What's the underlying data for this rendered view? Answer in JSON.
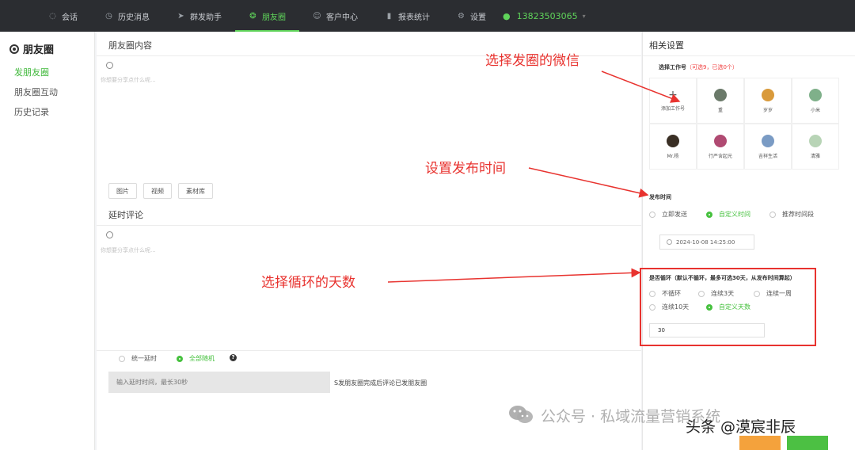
{
  "nav": {
    "items": [
      {
        "label": "会话",
        "icon": "chat-icon"
      },
      {
        "label": "历史消息",
        "icon": "clock-icon"
      },
      {
        "label": "群发助手",
        "icon": "send-icon"
      },
      {
        "label": "朋友圈",
        "icon": "moments-icon"
      },
      {
        "label": "客户中心",
        "icon": "user-icon"
      },
      {
        "label": "报表统计",
        "icon": "bar-chart-icon"
      },
      {
        "label": "设置",
        "icon": "gear-icon"
      }
    ],
    "active_index": 3,
    "phone": "13823503065"
  },
  "sidebar": {
    "title": "朋友圈",
    "items": [
      {
        "label": "发朋友圈",
        "active": true
      },
      {
        "label": "朋友圈互动",
        "active": false
      },
      {
        "label": "历史记录",
        "active": false
      }
    ]
  },
  "main": {
    "content_title": "朋友圈内容",
    "content_placeholder": "你想要分享点什么呢...",
    "media_buttons": [
      "图片",
      "视频",
      "素材库"
    ],
    "comment_title": "延时评论",
    "comment_placeholder": "你想要分享点什么呢...",
    "timing_options": [
      "统一延时",
      "全部随机"
    ],
    "timing_selected": 1,
    "delay_placeholder": "输入延时时间，最长30秒",
    "delay_note": "S发朋友圈完成后评论已发朋友圈"
  },
  "right": {
    "title": "相关设置",
    "select_label": "选择工作号",
    "select_hint": "（可选9，已选0个）",
    "add_label": "添加工作号",
    "accounts": [
      {
        "name": "重",
        "color": "#6b7a6a"
      },
      {
        "name": "岁岁",
        "color": "#d99a3b"
      },
      {
        "name": "小米",
        "color": "#7fb08a"
      },
      {
        "name": "Mr.杨",
        "color": "#3a2f25"
      },
      {
        "name": "行严含起光",
        "color": "#b04a72"
      },
      {
        "name": "吉祥生活",
        "color": "#7a9bc4"
      },
      {
        "name": "清雅",
        "color": "#b8d4b6"
      }
    ],
    "publish_label": "发布时间",
    "publish_options": [
      "立即发送",
      "自定义时间",
      "推荐时间段"
    ],
    "publish_selected": 1,
    "publish_datetime": "2024-10-08 14:25:00",
    "loop_label": "是否循环（默认不循环，最多可选30天，从发布时间算起）",
    "loop_options": [
      "不循环",
      "连续3天",
      "连续一周",
      "连续10天",
      "自定义天数"
    ],
    "loop_selected": 4,
    "loop_days": "30"
  },
  "annotations": {
    "a1": "选择发圈的微信",
    "a2": "设置发布时间",
    "a3": "选择循环的天数",
    "color": "#e8332f"
  },
  "watermark": {
    "text1": "公众号 · 私域流量营销系统",
    "text2": "头条 @漠宸非辰"
  },
  "colors": {
    "accent": "#47c13f",
    "nav_bg": "#2b2d31"
  }
}
